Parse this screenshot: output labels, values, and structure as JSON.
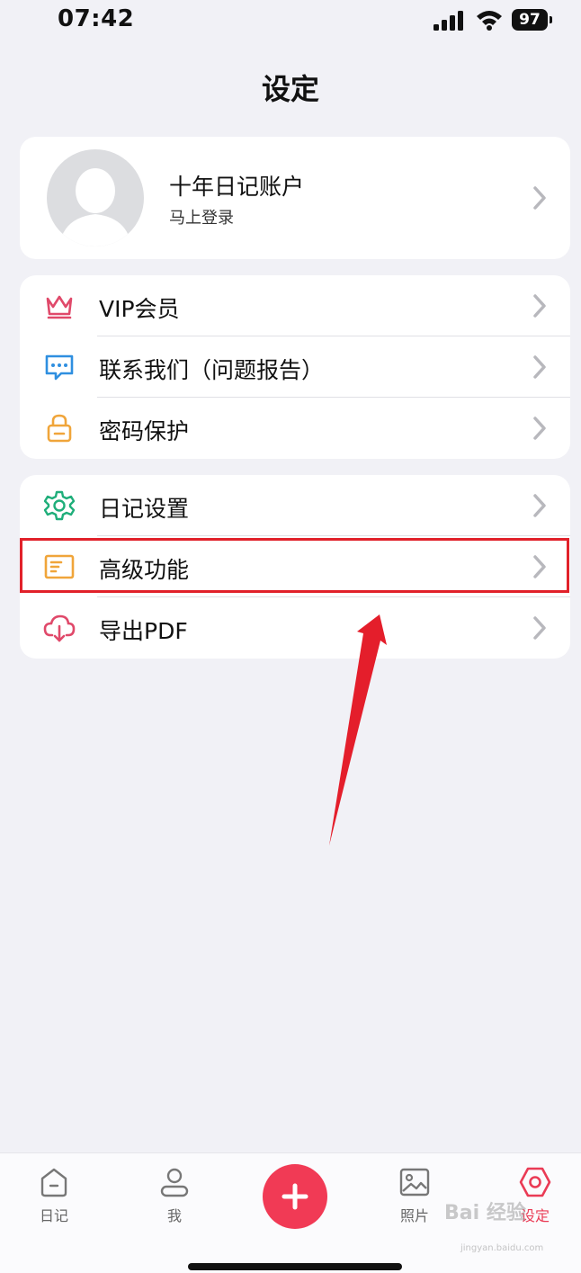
{
  "status_bar": {
    "time": "07:42",
    "battery": "97"
  },
  "header": {
    "title": "设定"
  },
  "profile": {
    "name": "十年日记账户",
    "subtitle": "马上登录"
  },
  "group1": {
    "items": [
      {
        "label": "VIP会员",
        "icon": "crown-icon"
      },
      {
        "label": "联系我们（问题报告）",
        "icon": "chat-bubble-icon"
      },
      {
        "label": "密码保护",
        "icon": "lock-icon"
      }
    ]
  },
  "group2": {
    "items": [
      {
        "label": "日记设置",
        "icon": "gear-icon"
      },
      {
        "label": "高级功能",
        "icon": "list-card-icon"
      },
      {
        "label": "导出PDF",
        "icon": "cloud-download-icon"
      }
    ]
  },
  "tab_bar": {
    "tabs": [
      {
        "label": "日记",
        "icon": "home-icon"
      },
      {
        "label": "我",
        "icon": "person-icon"
      },
      {
        "label": "",
        "icon": "plus-icon"
      },
      {
        "label": "照片",
        "icon": "image-icon"
      },
      {
        "label": "设定",
        "icon": "settings-hexagon-icon"
      }
    ],
    "active_index": 4
  },
  "watermark": {
    "text": "Bai 经验",
    "sub": "jingyan.baidu.com"
  },
  "colors": {
    "accent": "#ea3b55",
    "background": "#f1f1f6",
    "highlight": "#e1212a"
  }
}
